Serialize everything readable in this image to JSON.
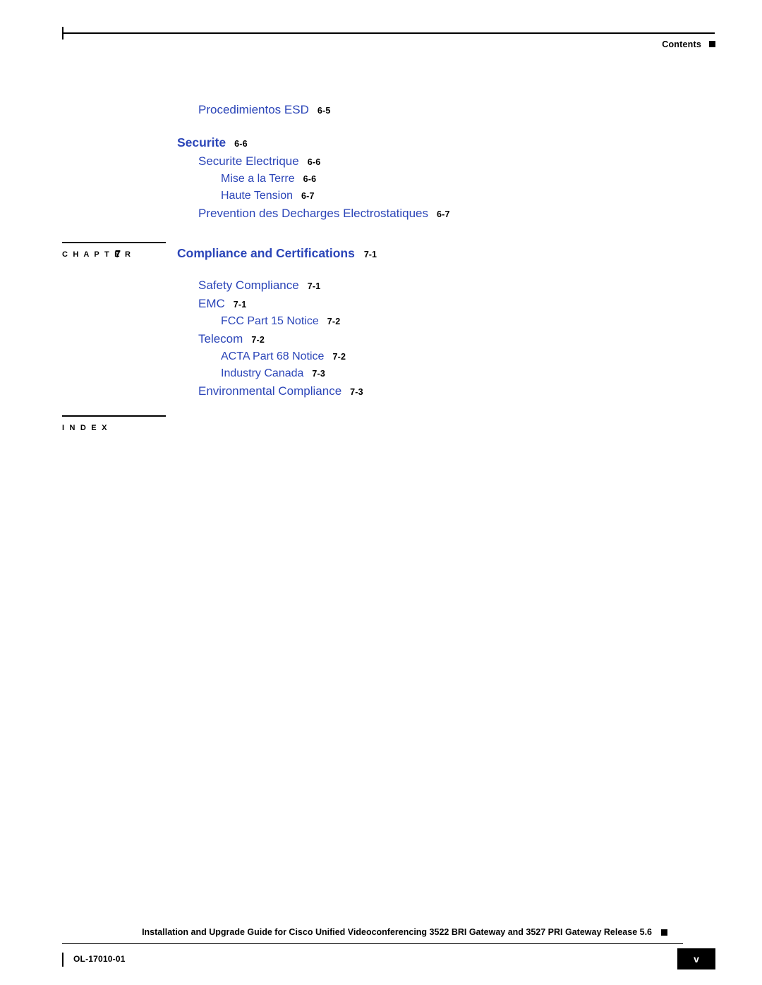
{
  "header": {
    "label": "Contents"
  },
  "toc": {
    "entries": [
      {
        "level": 1,
        "title": "Procedimientos ESD",
        "page": "6-5"
      },
      {
        "level": "head",
        "title": "Securite",
        "page": "6-6"
      },
      {
        "level": 1,
        "title": "Securite Electrique",
        "page": "6-6"
      },
      {
        "level": 2,
        "title": "Mise a la Terre",
        "page": "6-6"
      },
      {
        "level": 2,
        "title": "Haute Tension",
        "page": "6-7"
      },
      {
        "level": 1,
        "title": "Prevention des Decharges Electrostatiques",
        "page": "6-7"
      }
    ],
    "chapter": {
      "word": "C H A P T E R",
      "number": "7",
      "title": "Compliance and Certifications",
      "page": "7-1"
    },
    "chapter_entries": [
      {
        "level": 1,
        "title": "Safety Compliance",
        "page": "7-1"
      },
      {
        "level": 1,
        "title": "EMC",
        "page": "7-1"
      },
      {
        "level": 2,
        "title": "FCC Part 15 Notice",
        "page": "7-2"
      },
      {
        "level": 1,
        "title": "Telecom",
        "page": "7-2"
      },
      {
        "level": 2,
        "title": "ACTA Part 68 Notice",
        "page": "7-2"
      },
      {
        "level": 2,
        "title": "Industry Canada",
        "page": "7-3"
      },
      {
        "level": 1,
        "title": "Environmental Compliance",
        "page": "7-3"
      }
    ],
    "index": {
      "word": "I N D E X"
    }
  },
  "footer": {
    "title": "Installation and Upgrade Guide for Cisco Unified Videoconferencing 3522 BRI Gateway and 3527 PRI Gateway Release 5.6",
    "doc_id": "OL-17010-01",
    "page_number": "v"
  }
}
